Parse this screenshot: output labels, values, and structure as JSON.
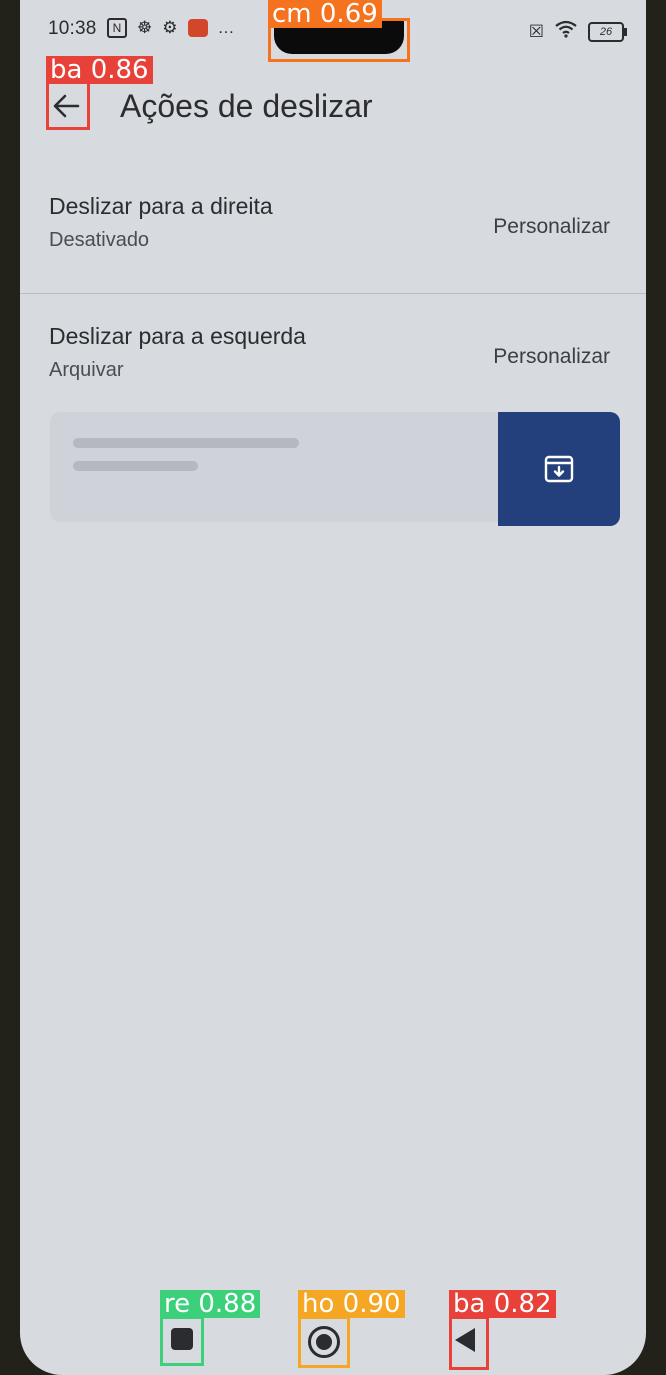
{
  "status_bar": {
    "time": "10:38",
    "icons_left": [
      "nfc-icon",
      "sim-icon",
      "settings-gear-icon",
      "mail-app-icon",
      "more-dots-icon"
    ],
    "battery_level": "26"
  },
  "app_bar": {
    "title": "Ações de deslizar"
  },
  "rows": [
    {
      "title": "Deslizar para a direita",
      "subtitle": "Desativado",
      "action_label": "Personalizar"
    },
    {
      "title": "Deslizar para a esquerda",
      "subtitle": "Arquivar",
      "action_label": "Personalizar"
    }
  ],
  "swipe_preview": {
    "action_icon": "archive-icon",
    "action_color": "#233f7c"
  },
  "detections": [
    {
      "label": "ba 0.86",
      "color": "#e8413a"
    },
    {
      "label": "cm 0.69",
      "color": "#f5731e"
    },
    {
      "label": "re 0.88",
      "color": "#3cd07a"
    },
    {
      "label": "ho 0.90",
      "color": "#f5a623"
    },
    {
      "label": "ba 0.82",
      "color": "#e8413a"
    }
  ]
}
